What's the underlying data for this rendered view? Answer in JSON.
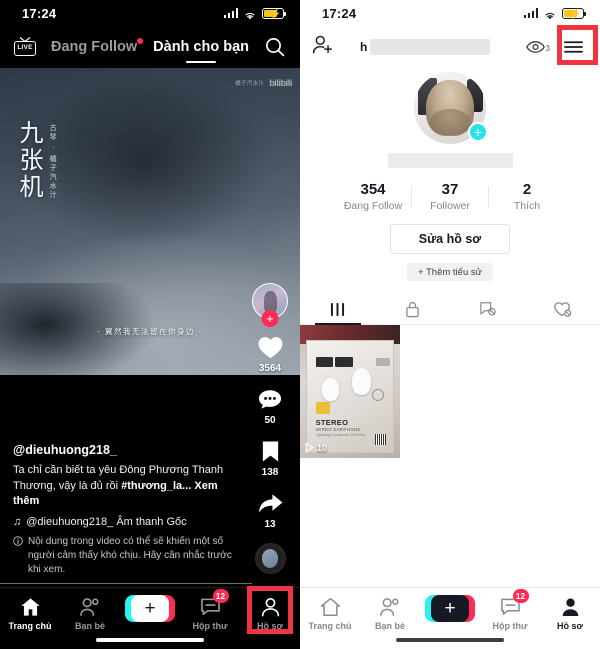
{
  "status_bar": {
    "time": "17:24",
    "icons": [
      "signal-icon",
      "wifi-icon",
      "battery-charging-icon"
    ]
  },
  "left_phone": {
    "header": {
      "live_label": "LIVE",
      "tabs": [
        {
          "label": "Đang Follow",
          "active": false,
          "dot": true
        },
        {
          "label": "Dành cho bạn",
          "active": true,
          "dot": false
        }
      ],
      "search_icon": "search-icon"
    },
    "video": {
      "watermark_text": "橘子汽水汁",
      "watermark_logo": "bilibili",
      "title_vertical": "九张机",
      "title_sub": "古琴 · 橘子汽水汁",
      "subtitle": "- 翼然我无法留在你身边 -"
    },
    "rail": {
      "follow_plus": "+",
      "like_count": "3564",
      "comment_count": "50",
      "bookmark_count": "138",
      "share_count": "13"
    },
    "caption": {
      "username": "@dieuhuong218_",
      "text_line1": "Ta chỉ cần biết ta yêu Đông Phương Thanh",
      "text_line2": "Thương, vậy là đủ rồi ",
      "hashtag": "#thương_la...",
      "more": "Xem thêm",
      "music": "@dieuhuong218_ Âm thanh Gốc",
      "warning": "Nội dung trong video có thể sẽ khiến một số người cảm thấy khó chịu. Hãy cân nhắc trước khi xem."
    },
    "nav": [
      {
        "label": "Trang chủ",
        "icon": "home-icon",
        "active": true,
        "badge": ""
      },
      {
        "label": "Bạn bè",
        "icon": "friends-icon",
        "active": false,
        "badge": ""
      },
      {
        "label": "",
        "icon": "create-plus-icon",
        "active": false,
        "badge": ""
      },
      {
        "label": "Hộp thư",
        "icon": "inbox-icon",
        "active": false,
        "badge": "12"
      },
      {
        "label": "Hồ sơ",
        "icon": "profile-icon",
        "active": false,
        "badge": ""
      }
    ]
  },
  "right_phone": {
    "header": {
      "add_user_icon": "add-user-icon",
      "name_prefix": "h",
      "views_icon": "views-eye-icon",
      "views_count": "3",
      "menu_icon": "hamburger-menu-icon"
    },
    "profile": {
      "avatar_plus": "+",
      "stats": [
        {
          "value": "354",
          "label": "Đang Follow"
        },
        {
          "value": "37",
          "label": "Follower"
        },
        {
          "value": "2",
          "label": "Thích"
        }
      ],
      "edit_button": "Sửa hồ sơ",
      "bio_button": "+ Thêm tiểu sử",
      "tabs": [
        {
          "icon": "grid-posts-icon",
          "active": true
        },
        {
          "icon": "lock-private-icon",
          "active": false
        },
        {
          "icon": "repost-icon",
          "active": false
        },
        {
          "icon": "liked-heart-icon",
          "active": false
        }
      ],
      "posts": [
        {
          "play_count": "10",
          "label_main": "STEREO",
          "label_sub": "WIRED EARPHONE",
          "label_sub2": "Lightning Connector Wireless"
        }
      ]
    },
    "nav": [
      {
        "label": "Trang chủ",
        "icon": "home-icon",
        "active": false,
        "badge": ""
      },
      {
        "label": "Bạn bè",
        "icon": "friends-icon",
        "active": false,
        "badge": ""
      },
      {
        "label": "",
        "icon": "create-plus-icon",
        "active": false,
        "badge": ""
      },
      {
        "label": "Hộp thư",
        "icon": "inbox-icon",
        "active": false,
        "badge": "12"
      },
      {
        "label": "Hồ sơ",
        "icon": "profile-icon",
        "active": true,
        "badge": ""
      }
    ]
  },
  "annotations": {
    "highlight_color": "#ef3340",
    "boxes": [
      "menu-button-highlight",
      "profile-tab-highlight"
    ]
  }
}
